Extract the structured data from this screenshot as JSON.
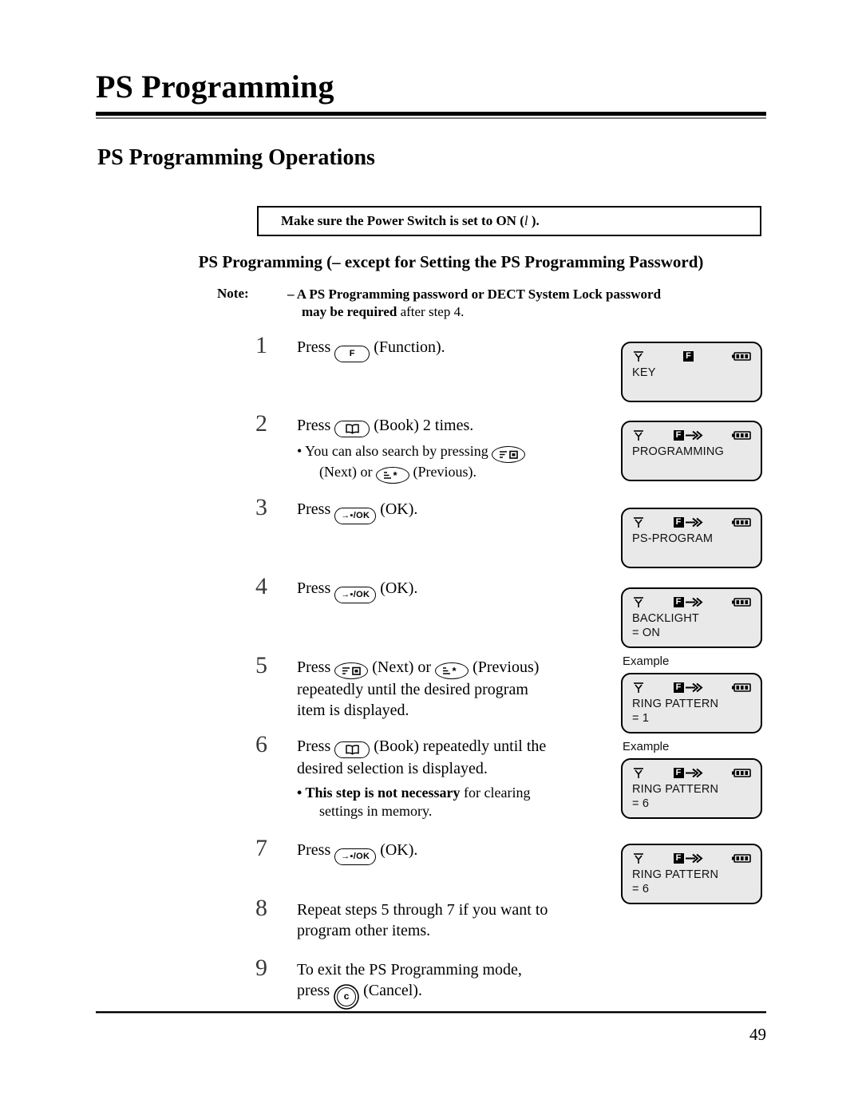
{
  "header": {
    "title": "PS Programming",
    "section_title": "PS Programming Operations"
  },
  "callout": {
    "text_before": "Make sure the Power Switch is set to ON (",
    "symbol": "l",
    "text_after": " ).",
    "full_text": "Make sure the Power Switch is set to ON (l )."
  },
  "sub_heading": "PS Programming (– except for Setting the PS Programming Password)",
  "note": {
    "label": "Note:",
    "line1": "– A PS Programming password or DECT System Lock password",
    "line2_bold": "may be required",
    "line2_rest": " after step 4."
  },
  "steps": [
    {
      "num": "1",
      "pre": "Press ",
      "key": "F",
      "post": " (Function)."
    },
    {
      "num": "2",
      "pre": "Press ",
      "key": "book",
      "post": " (Book) 2 times.",
      "bullet_pre": "• You can also search by pressing ",
      "bullet_key_next": "next",
      "bullet_mid": "(Next) or ",
      "bullet_key_prev": "previous",
      "bullet_post": " (Previous)."
    },
    {
      "num": "3",
      "pre": "Press ",
      "key": "ok",
      "post": " (OK)."
    },
    {
      "num": "4",
      "pre": "Press ",
      "key": "ok",
      "post": " (OK)."
    },
    {
      "num": "5",
      "pre": "Press ",
      "key": "next",
      "mid": " (Next) or ",
      "key2": "previous",
      "post": " (Previous)",
      "line2": "repeatedly until the desired program",
      "line3": "item is displayed."
    },
    {
      "num": "6",
      "pre": "Press ",
      "key": "book",
      "post": " (Book) repeatedly until the",
      "line2": "desired selection is displayed.",
      "bullet_bold": "• This step is not necessary",
      "bullet_rest": " for clearing",
      "bullet_line2": "settings in memory."
    },
    {
      "num": "7",
      "pre": "Press ",
      "key": "ok",
      "post": " (OK)."
    },
    {
      "num": "8",
      "line1": "Repeat steps 5 through 7 if you want to",
      "line2": "program other items."
    },
    {
      "num": "9",
      "line1": "To exit the PS Programming mode,",
      "pre": "press ",
      "key": "cancel",
      "post": " (Cancel)."
    }
  ],
  "displays": [
    {
      "f_indicator": "F",
      "has_arrow": false,
      "line1": "KEY",
      "line2": "",
      "example_label": ""
    },
    {
      "f_indicator": "F",
      "has_arrow": true,
      "line1": "PROGRAMMING",
      "line2": "",
      "example_label": ""
    },
    {
      "f_indicator": "F",
      "has_arrow": true,
      "line1": "PS-PROGRAM",
      "line2": "",
      "example_label": ""
    },
    {
      "f_indicator": "F",
      "has_arrow": true,
      "line1": "BACKLIGHT",
      "line2": "= ON",
      "example_label": ""
    },
    {
      "f_indicator": "F",
      "has_arrow": true,
      "line1": "RING PATTERN",
      "line2": "= 1",
      "example_label": "Example"
    },
    {
      "f_indicator": "F",
      "has_arrow": true,
      "line1": "RING PATTERN",
      "line2": "= 6",
      "example_label": "Example"
    },
    {
      "f_indicator": "F",
      "has_arrow": true,
      "line1": "RING PATTERN",
      "line2": "= 6",
      "example_label": ""
    }
  ],
  "footer": {
    "page_number": "49"
  },
  "colors": {
    "lcd_bg": "#e9e9e9",
    "ink": "#000000",
    "rule_gray": "#7a7a7a"
  }
}
